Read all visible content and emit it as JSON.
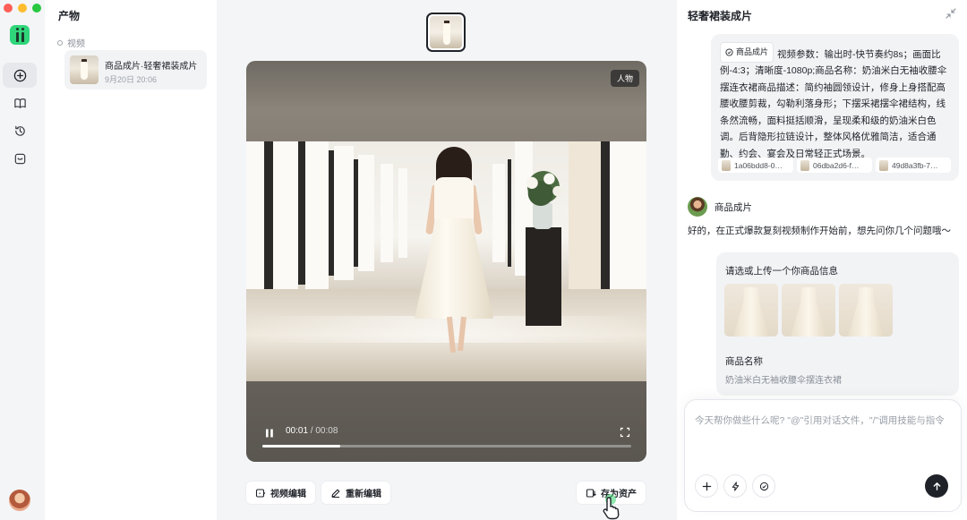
{
  "colors": {
    "traffic_red": "#ff5f57",
    "traffic_yellow": "#febc2e",
    "traffic_green": "#28c840",
    "brand_green": "#2fd67a",
    "send_button": "#1f2329"
  },
  "rail": {
    "items": [
      {
        "icon": "plus-circle-icon"
      },
      {
        "icon": "book-icon"
      },
      {
        "icon": "history-icon"
      },
      {
        "icon": "inbox-icon"
      }
    ]
  },
  "projects": {
    "title": "产物",
    "group_label": "视频",
    "items": [
      {
        "name": "商品成片·轻奢裙装成片",
        "date": "9月20日 20:06"
      }
    ]
  },
  "player": {
    "tag": "人物",
    "current_time": "00:01",
    "separator": " / ",
    "total_time": "00:08",
    "progress": 0.21
  },
  "actions": {
    "edit_video": "视频编辑",
    "re_edit": "重新编辑",
    "save_asset": "存为资产"
  },
  "chat": {
    "title": "轻奢裙装成片",
    "user_message": {
      "skill_chip": "商品成片",
      "text": "视频参数：输出时-快节奏约8s；画面比例-4:3；清晰度-1080p;商品名称：奶油米白无袖收腰伞摆连衣裙商品描述：简约袖圆领设计，修身上身搭配高腰收腰剪裁，勾勒利落身形；下摆采裙摆伞裙结构，线条然流畅，面料挺括顺滑，呈现柔和级的奶油米白色调。后背隐形拉链设计，整体风格优雅简洁，适合通勤、约会、宴会及日常轻正式场景。",
      "attachments": [
        "1a06bdd8-0…",
        "06dba2d6-f…",
        "49d8a3fb-7…"
      ]
    },
    "agent": {
      "name": "商品成片",
      "message": "好的，在正式爆款复刻视频制作开始前，想先问你几个问题哦～"
    },
    "form": {
      "title": "请选或上传一个你商品信息",
      "field_label": "商品名称",
      "field_value": "奶油米白无袖收腰伞摆连衣裙"
    },
    "composer": {
      "placeholder": "今天帮你做些什么呢? \"@\"引用对话文件，\"/\"调用技能与指令"
    }
  }
}
